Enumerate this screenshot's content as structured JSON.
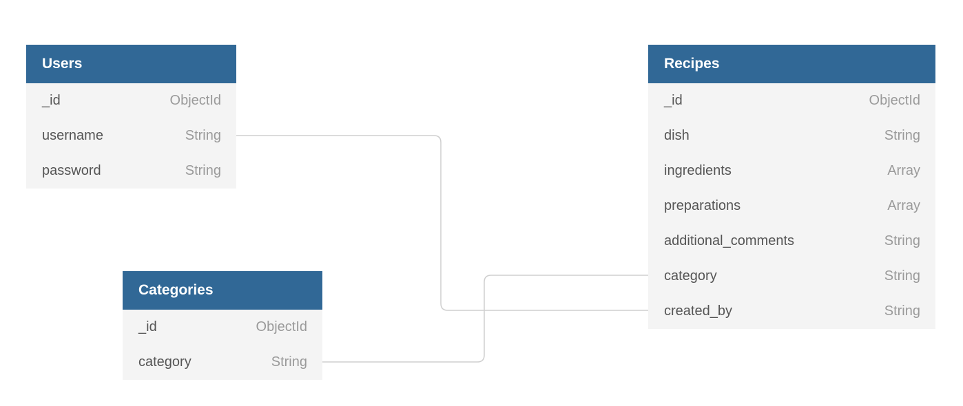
{
  "tables": {
    "users": {
      "title": "Users",
      "fields": [
        {
          "name": "_id",
          "type": "ObjectId"
        },
        {
          "name": "username",
          "type": "String"
        },
        {
          "name": "password",
          "type": "String"
        }
      ]
    },
    "categories": {
      "title": "Categories",
      "fields": [
        {
          "name": "_id",
          "type": "ObjectId"
        },
        {
          "name": "category",
          "type": "String"
        }
      ]
    },
    "recipes": {
      "title": "Recipes",
      "fields": [
        {
          "name": "_id",
          "type": "ObjectId"
        },
        {
          "name": "dish",
          "type": "String"
        },
        {
          "name": "ingredients",
          "type": "Array"
        },
        {
          "name": "preparations",
          "type": "Array"
        },
        {
          "name": "additional_comments",
          "type": "String"
        },
        {
          "name": "category",
          "type": "String"
        },
        {
          "name": "created_by",
          "type": "String"
        }
      ]
    }
  },
  "relations": [
    {
      "from": "users.username",
      "to": "recipes.created_by"
    },
    {
      "from": "categories.category",
      "to": "recipes.category"
    }
  ],
  "colors": {
    "header": "#316896",
    "body": "#f4f4f4",
    "connector": "#cfcfcf"
  }
}
